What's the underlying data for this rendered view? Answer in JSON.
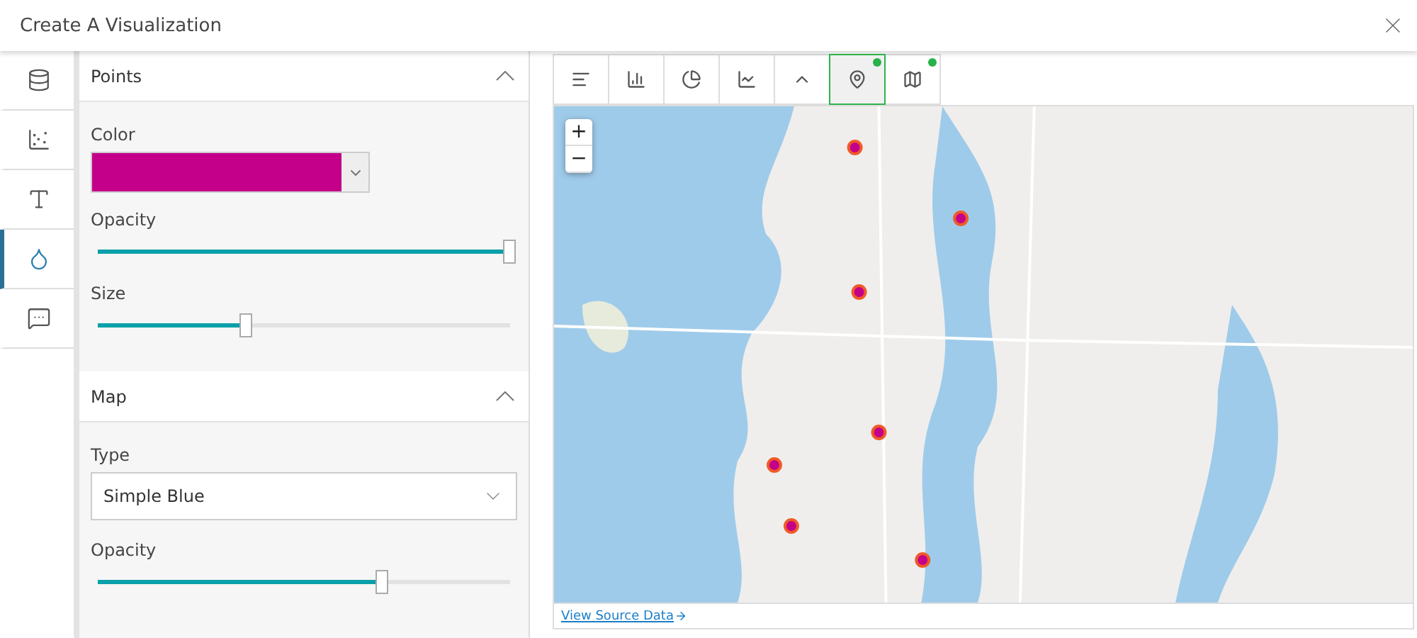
{
  "window": {
    "title": "Create A Visualization"
  },
  "rail": [
    {
      "selected": false
    },
    {
      "selected": false
    },
    {
      "selected": false
    },
    {
      "selected": true
    },
    {
      "selected": false
    }
  ],
  "sections": [
    {
      "title": "Points",
      "expanded": true,
      "fields": [
        {
          "kind": "color",
          "label": "Color",
          "color": "#c4008a"
        },
        {
          "kind": "slider",
          "label": "Opacity",
          "level": 1
        },
        {
          "kind": "slider",
          "label": "Size",
          "level": 0.36
        }
      ]
    },
    {
      "title": "Map",
      "expanded": true,
      "fields": [
        {
          "kind": "select",
          "label": "Type",
          "value": "Simple Blue"
        },
        {
          "kind": "slider",
          "label": "Opacity",
          "level": 0.69
        }
      ]
    }
  ],
  "chart_types": [
    {
      "selected": false,
      "badge": false
    },
    {
      "selected": false,
      "badge": false
    },
    {
      "selected": false,
      "badge": false
    },
    {
      "selected": false,
      "badge": false
    },
    {
      "selected": false,
      "badge": false
    },
    {
      "selected": true,
      "badge": true
    },
    {
      "selected": false,
      "badge": true
    }
  ],
  "map": {
    "zoom": [
      "+",
      "−"
    ]
  },
  "footer": {
    "link": "View Source Data"
  }
}
